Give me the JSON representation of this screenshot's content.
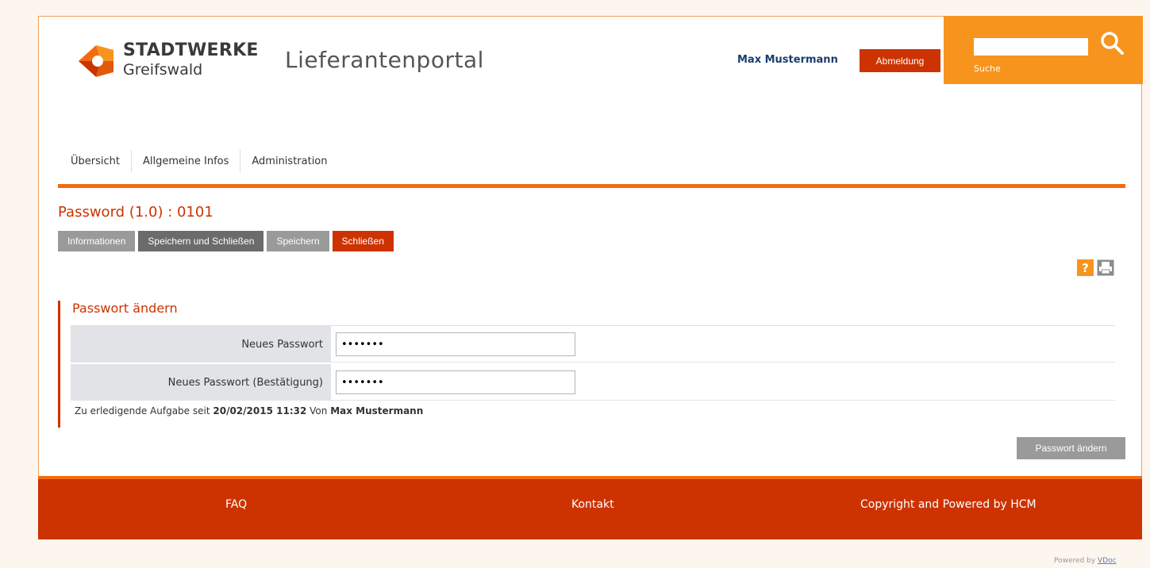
{
  "header": {
    "brand_line1": "STADTWERKE",
    "brand_line2": "Greifswald",
    "portal_title": "Lieferantenportal",
    "user_name": "Max Mustermann",
    "logout_label": "Abmeldung",
    "search_label": "Suche",
    "search_value": ""
  },
  "nav": {
    "items": [
      {
        "label": "Übersicht"
      },
      {
        "label": "Allgemeine Infos"
      },
      {
        "label": "Administration"
      }
    ]
  },
  "document": {
    "title": "Password (1.0) : 0101",
    "toolbar": {
      "info_label": "Informationen",
      "save_close_label": "Speichern und Schließen",
      "save_label": "Speichern",
      "close_label": "Schließen"
    },
    "help_symbol": "?"
  },
  "form": {
    "section_title": "Passwort ändern",
    "fields": [
      {
        "label": "Neues Passwort",
        "value": "•••••••"
      },
      {
        "label": "Neues Passwort (Bestätigung)",
        "value": "•••••••"
      }
    ],
    "task_prefix": "Zu erledigende Aufgabe seit",
    "task_date": "20/02/2015 11:32",
    "task_by": "Von",
    "task_user": "Max Mustermann",
    "submit_label": "Passwort ändern"
  },
  "footer": {
    "faq": "FAQ",
    "contact": "Kontakt",
    "copyright": "Copyright and Powered by HCM"
  },
  "powered_by": {
    "prefix": "Powered by",
    "vendor": "VDoc"
  },
  "colors": {
    "brand_red": "#cc3300",
    "brand_orange": "#f7941d",
    "rule_orange": "#f26b0f",
    "user_blue": "#1b3d6e"
  }
}
